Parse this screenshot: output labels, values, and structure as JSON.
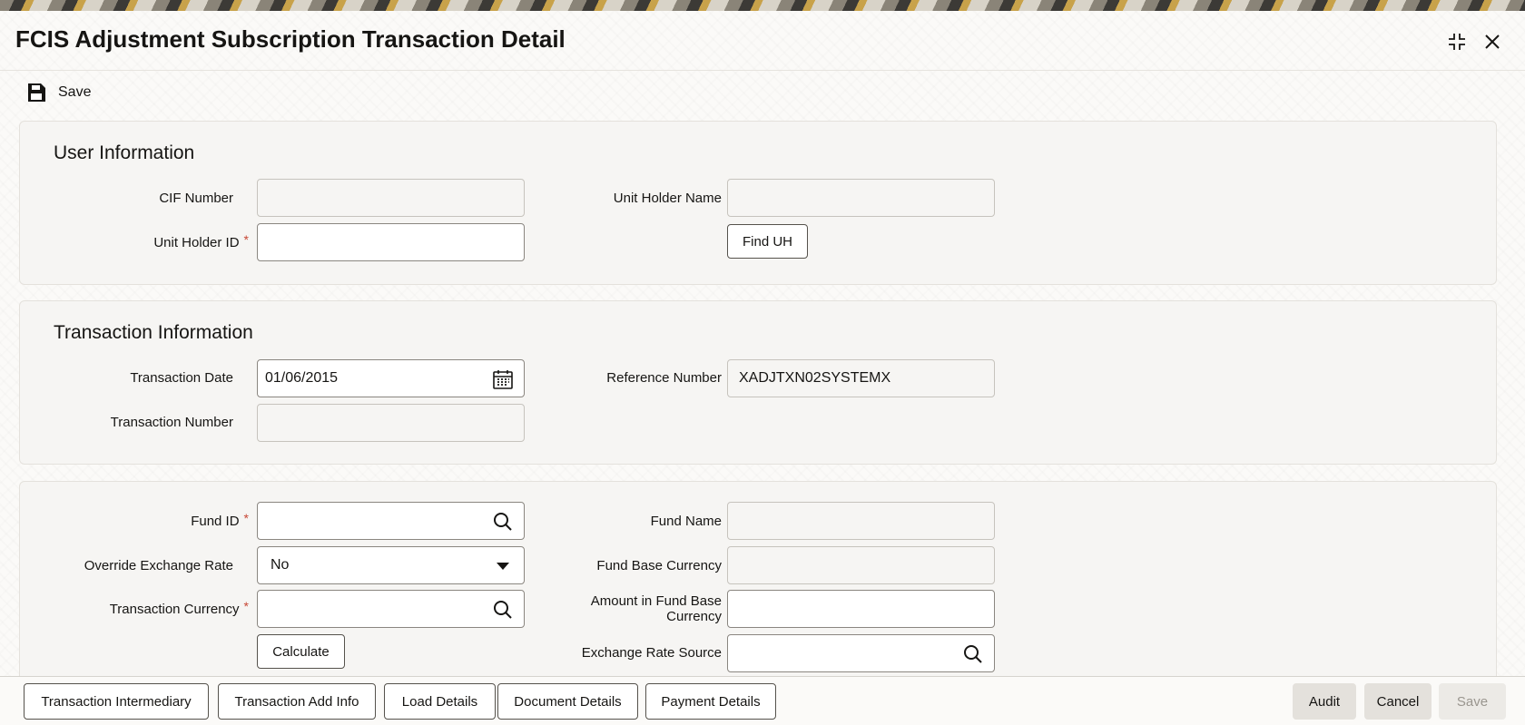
{
  "window": {
    "title": "FCIS Adjustment Subscription Transaction Detail"
  },
  "toolbar": {
    "save_label": "Save"
  },
  "user_information": {
    "title": "User Information",
    "cif_number_label": "CIF Number",
    "cif_number_value": "",
    "unit_holder_id_label": "Unit Holder ID",
    "unit_holder_id_value": "",
    "unit_holder_name_label": "Unit Holder Name",
    "unit_holder_name_value": "",
    "find_uh_label": "Find UH"
  },
  "transaction_information": {
    "title": "Transaction Information",
    "transaction_date_label": "Transaction Date",
    "transaction_date_value": "01/06/2015",
    "reference_number_label": "Reference Number",
    "reference_number_value": "XADJTXN02SYSTEMX",
    "transaction_number_label": "Transaction Number",
    "transaction_number_value": ""
  },
  "fund_details": {
    "fund_id_label": "Fund ID",
    "fund_id_value": "",
    "fund_name_label": "Fund Name",
    "fund_name_value": "",
    "override_exchange_rate_label": "Override Exchange Rate",
    "override_exchange_rate_value": "No",
    "fund_base_currency_label": "Fund Base Currency",
    "fund_base_currency_value": "",
    "transaction_currency_label": "Transaction Currency",
    "transaction_currency_value": "",
    "amount_in_fund_base_currency_label_line1": "Amount in Fund Base",
    "amount_in_fund_base_currency_label_line2": "Currency",
    "amount_in_fund_base_currency_value": "",
    "calculate_label": "Calculate",
    "exchange_rate_source_label": "Exchange Rate Source",
    "exchange_rate_source_value": ""
  },
  "footer": {
    "transaction_intermediary": "Transaction Intermediary",
    "transaction_add_info": "Transaction Add Info",
    "load_details": "Load Details",
    "document_details": "Document Details",
    "payment_details": "Payment Details",
    "audit": "Audit",
    "cancel": "Cancel",
    "save": "Save"
  },
  "required_marker": "*",
  "icons": {
    "save": "save-icon",
    "minimize": "minimize-icon",
    "close": "close-icon",
    "calendar": "calendar-icon",
    "search": "search-icon",
    "dropdown": "chevron-down-icon"
  }
}
